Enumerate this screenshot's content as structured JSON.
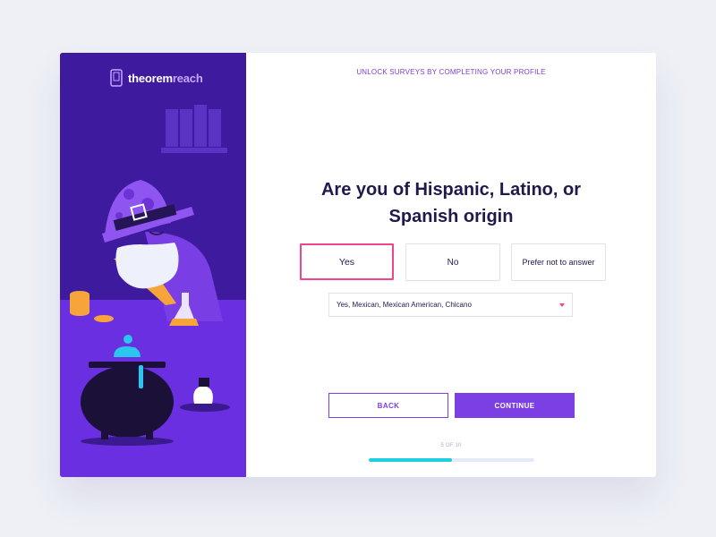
{
  "brand": {
    "name_part1": "theorem",
    "name_part2": "reach",
    "logo_icon": "phone-icon"
  },
  "header": {
    "note": "UNLOCK SURVEYS BY COMPLETING YOUR PROFILE"
  },
  "question": {
    "title_line1": "Are you of Hispanic, Latino, or",
    "title_line2": "Spanish origin"
  },
  "options": [
    {
      "label": "Yes",
      "selected": true
    },
    {
      "label": "No",
      "selected": false
    },
    {
      "label": "Prefer not to answer",
      "selected": false
    }
  ],
  "dropdown": {
    "selected": "Yes, Mexican, Mexican American, Chicano",
    "icon": "caret-down-icon"
  },
  "actions": {
    "back": "BACK",
    "continue": "CONTINUE"
  },
  "progress": {
    "label": "5 OF 10",
    "fraction": 0.5
  },
  "colors": {
    "primary": "#7b3fe4",
    "accent_pink": "#f0448c",
    "progress": "#1dd0e0",
    "panel": "#4c1db5"
  }
}
